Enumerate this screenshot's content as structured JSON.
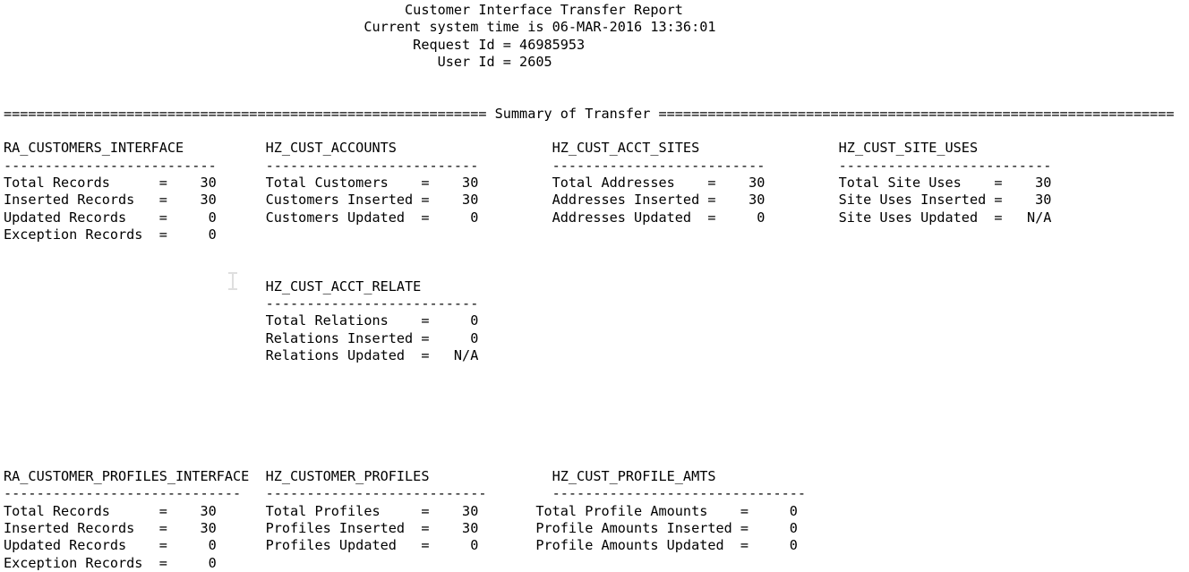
{
  "report": {
    "title": "Customer Interface Transfer Report",
    "system_time_line": "Current system time is 06-MAR-2016 13:36:01",
    "system_time_label": "Current system time is",
    "system_time_value": "06-MAR-2016 13:36:01",
    "request_id_label": "Request Id",
    "request_id_value": "46985953",
    "user_id_label": "User Id",
    "user_id_value": "2605",
    "summary_banner_label": "Summary of Transfer",
    "banner_fill_char": "=",
    "rule_char": "-",
    "na_value": "N/A",
    "equals_sign": "="
  },
  "sections": [
    {
      "name": "summary-row-1",
      "tables": [
        {
          "heading": "RA_CUSTOMERS_INTERFACE",
          "rule": "--------------------------",
          "rows": [
            {
              "label": "Total Records",
              "value": "30"
            },
            {
              "label": "Inserted Records",
              "value": "30"
            },
            {
              "label": "Updated Records",
              "value": "0"
            },
            {
              "label": "Exception Records",
              "value": "0"
            }
          ]
        },
        {
          "heading": "HZ_CUST_ACCOUNTS",
          "rule": "--------------------------",
          "rows": [
            {
              "label": "Total Customers",
              "value": "30"
            },
            {
              "label": "Customers Inserted",
              "value": "30"
            },
            {
              "label": "Customers Updated",
              "value": "0"
            }
          ]
        },
        {
          "heading": "HZ_CUST_ACCT_SITES",
          "rule": "--------------------------",
          "rows": [
            {
              "label": "Total Addresses",
              "value": "30"
            },
            {
              "label": "Addresses Inserted",
              "value": "30"
            },
            {
              "label": "Addresses Updated",
              "value": "0"
            }
          ]
        },
        {
          "heading": "HZ_CUST_SITE_USES",
          "rule": "--------------------------",
          "rows": [
            {
              "label": "Total Site Uses",
              "value": "30"
            },
            {
              "label": "Site Uses Inserted",
              "value": "30"
            },
            {
              "label": "Site Uses Updated",
              "value": "N/A"
            }
          ]
        }
      ]
    },
    {
      "name": "summary-row-2",
      "tables": [
        {
          "heading": "HZ_CUST_ACCT_RELATE",
          "rule": "--------------------------",
          "rows": [
            {
              "label": "Total Relations",
              "value": "0"
            },
            {
              "label": "Relations Inserted",
              "value": "0"
            },
            {
              "label": "Relations Updated",
              "value": "N/A"
            }
          ]
        }
      ]
    },
    {
      "name": "summary-row-3",
      "tables": [
        {
          "heading": "RA_CUSTOMER_PROFILES_INTERFACE",
          "rule": "-----------------------------",
          "rows": [
            {
              "label": "Total Records",
              "value": "30"
            },
            {
              "label": "Inserted Records",
              "value": "30"
            },
            {
              "label": "Updated Records",
              "value": "0"
            },
            {
              "label": "Exception Records",
              "value": "0"
            }
          ]
        },
        {
          "heading": "HZ_CUSTOMER_PROFILES",
          "rule": "---------------------------",
          "rows": [
            {
              "label": "Total Profiles",
              "value": "30"
            },
            {
              "label": "Profiles Inserted",
              "value": "30"
            },
            {
              "label": "Profiles Updated",
              "value": "0"
            }
          ]
        },
        {
          "heading": "HZ_CUST_PROFILE_AMTS",
          "rule": "-------------------------------",
          "rows": [
            {
              "label": "Total Profile Amounts",
              "value": "0"
            },
            {
              "label": "Profile Amounts Inserted",
              "value": "0"
            },
            {
              "label": "Profile Amounts Updated",
              "value": "0"
            }
          ]
        }
      ]
    }
  ],
  "lines": [
    "                                                 Customer Interface Transfer Report",
    "                                            Current system time is 06-MAR-2016 13:36:01",
    "                                                  Request Id = 46985953",
    "                                                     User Id = 2605",
    "",
    "",
    "=========================================================== Summary of Transfer ===============================================================",
    "",
    "RA_CUSTOMERS_INTERFACE          HZ_CUST_ACCOUNTS                   HZ_CUST_ACCT_SITES                 HZ_CUST_SITE_USES",
    "--------------------------      --------------------------         --------------------------         --------------------------",
    "Total Records      =    30      Total Customers    =    30         Total Addresses    =    30         Total Site Uses    =    30",
    "Inserted Records   =    30      Customers Inserted =    30         Addresses Inserted =    30         Site Uses Inserted =    30",
    "Updated Records    =     0      Customers Updated  =     0         Addresses Updated  =     0         Site Uses Updated  =   N/A",
    "Exception Records  =     0",
    "",
    "",
    "                                HZ_CUST_ACCT_RELATE",
    "                                --------------------------",
    "                                Total Relations    =     0",
    "                                Relations Inserted =     0",
    "                                Relations Updated  =   N/A",
    "",
    "",
    "",
    "",
    "",
    "",
    "RA_CUSTOMER_PROFILES_INTERFACE  HZ_CUSTOMER_PROFILES               HZ_CUST_PROFILE_AMTS",
    "-----------------------------   ---------------------------        -------------------------------",
    "Total Records      =    30      Total Profiles     =    30       Total Profile Amounts    =     0",
    "Inserted Records   =    30      Profiles Inserted  =    30       Profile Amounts Inserted =     0",
    "Updated Records    =     0      Profiles Updated   =     0       Profile Amounts Updated  =     0",
    "Exception Records  =     0"
  ]
}
